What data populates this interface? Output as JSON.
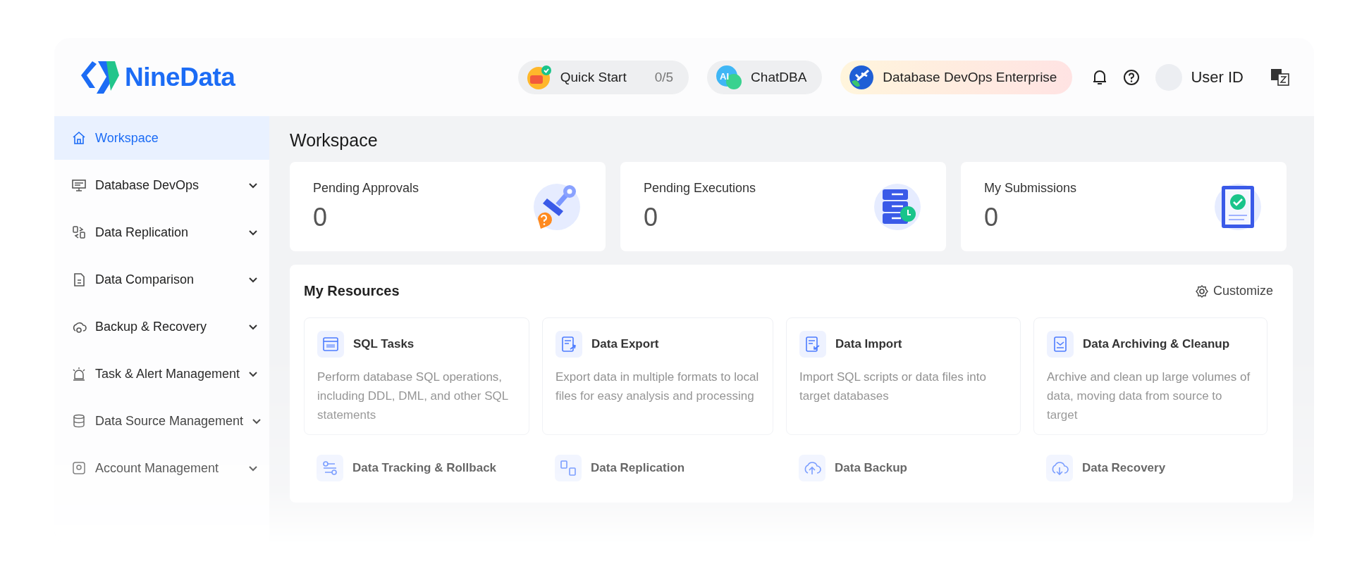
{
  "header": {
    "logo": "NineData",
    "quick_start": {
      "label": "Quick Start",
      "progress": "0/5"
    },
    "chatdba": {
      "icon_label": "AI",
      "label": "ChatDBA"
    },
    "edition": "Database DevOps Enterprise",
    "user": "User ID"
  },
  "sidebar": {
    "items": [
      {
        "label": "Workspace",
        "kind": "link",
        "selected": true
      },
      {
        "label": "Database DevOps",
        "kind": "group",
        "selected": false
      },
      {
        "label": "Data Replication",
        "kind": "group",
        "selected": false
      },
      {
        "label": "Data Comparison",
        "kind": "group",
        "selected": false
      },
      {
        "label": "Backup & Recovery",
        "kind": "group",
        "selected": false
      },
      {
        "label": "Task & Alert Management",
        "kind": "group",
        "selected": false
      },
      {
        "label": "Data Source Management",
        "kind": "group",
        "selected": false
      },
      {
        "label": "Account Management",
        "kind": "group",
        "selected": false
      }
    ]
  },
  "page_title": "Workspace",
  "stats": [
    {
      "label": "Pending Approvals",
      "value": "0",
      "kind": "stamp"
    },
    {
      "label": "Pending Executions",
      "value": "0",
      "kind": "server"
    },
    {
      "label": "My Submissions",
      "value": "0",
      "kind": "report"
    }
  ],
  "resources": {
    "title": "My Resources",
    "customize": "Customize",
    "items": [
      {
        "title": "SQL Tasks",
        "description": "Perform database SQL operations, including DDL, DML, and other SQL statements"
      },
      {
        "title": "Data Export",
        "description": "Export data in multiple formats to local files for easy analysis and processing"
      },
      {
        "title": "Data Import",
        "description": "Import SQL scripts or data files into target databases"
      },
      {
        "title": "Data Archiving & Cleanup",
        "description": "Archive and clean up large volumes of data, moving data from source to target"
      },
      {
        "title": "Data Tracking & Rollback"
      },
      {
        "title": "Data Replication"
      },
      {
        "title": "Data Backup"
      },
      {
        "title": "Data Recovery"
      }
    ]
  }
}
